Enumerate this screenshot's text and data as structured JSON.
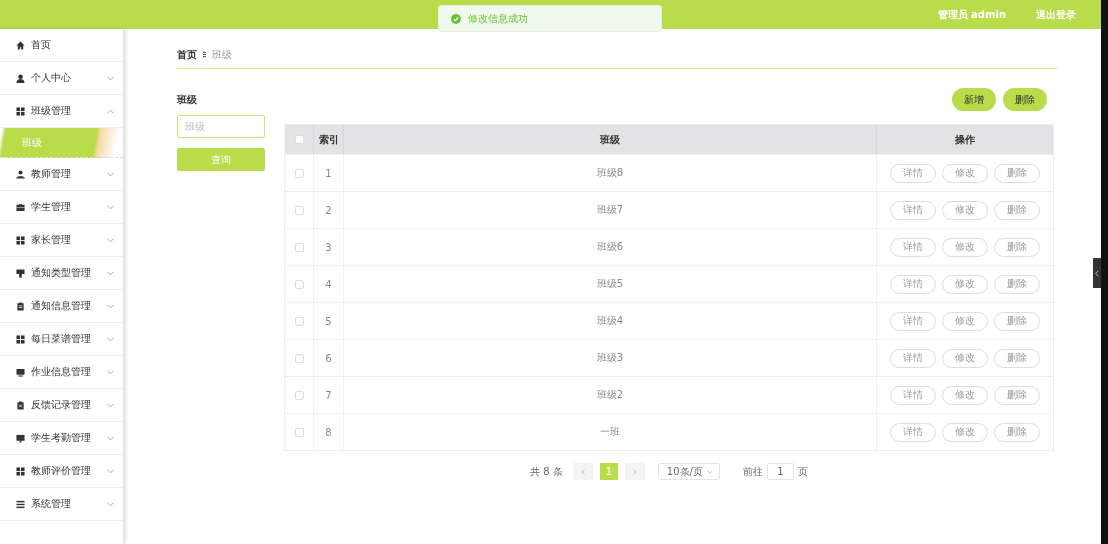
{
  "header": {
    "user": "管理员 admin",
    "logout": "退出登录"
  },
  "toast": {
    "message": "修改信息成功"
  },
  "sidebar": {
    "items": [
      {
        "label": "首页",
        "kind": "link"
      },
      {
        "label": "个人中心",
        "kind": "group",
        "expanded": false
      },
      {
        "label": "班级管理",
        "kind": "group",
        "expanded": true,
        "children": [
          {
            "label": "班级",
            "selected": true
          }
        ]
      },
      {
        "label": "教师管理",
        "kind": "group",
        "expanded": false
      },
      {
        "label": "学生管理",
        "kind": "group",
        "expanded": false
      },
      {
        "label": "家长管理",
        "kind": "group",
        "expanded": false
      },
      {
        "label": "通知类型管理",
        "kind": "group",
        "expanded": false
      },
      {
        "label": "通知信息管理",
        "kind": "group",
        "expanded": false
      },
      {
        "label": "每日菜谱管理",
        "kind": "group",
        "expanded": false
      },
      {
        "label": "作业信息管理",
        "kind": "group",
        "expanded": false
      },
      {
        "label": "反馈记录管理",
        "kind": "group",
        "expanded": false
      },
      {
        "label": "学生考勤管理",
        "kind": "group",
        "expanded": false
      },
      {
        "label": "教师评价管理",
        "kind": "group",
        "expanded": false
      },
      {
        "label": "系统管理",
        "kind": "group",
        "expanded": false
      }
    ]
  },
  "breadcrumb": [
    "首页",
    "班级"
  ],
  "search": {
    "label": "班级",
    "placeholder": "班级",
    "button": "查询"
  },
  "actions": [
    "新增",
    "删除"
  ],
  "table": {
    "columns": [
      "",
      "索引",
      "班级",
      "操作"
    ],
    "rows": [
      {
        "checked": false,
        "index": "1",
        "class": "班级8",
        "ops": [
          "详情",
          "修改",
          "删除"
        ]
      },
      {
        "checked": false,
        "index": "2",
        "class": "班级7",
        "ops": [
          "详情",
          "修改",
          "删除"
        ]
      },
      {
        "checked": false,
        "index": "3",
        "class": "班级6",
        "ops": [
          "详情",
          "修改",
          "删除"
        ]
      },
      {
        "checked": false,
        "index": "4",
        "class": "班级5",
        "ops": [
          "详情",
          "修改",
          "删除"
        ]
      },
      {
        "checked": false,
        "index": "5",
        "class": "班级4",
        "ops": [
          "详情",
          "修改",
          "删除"
        ]
      },
      {
        "checked": false,
        "index": "6",
        "class": "班级3",
        "ops": [
          "详情",
          "修改",
          "删除"
        ]
      },
      {
        "checked": false,
        "index": "7",
        "class": "班级2",
        "ops": [
          "详情",
          "修改",
          "删除"
        ]
      },
      {
        "checked": false,
        "index": "8",
        "class": "一班",
        "ops": [
          "详情",
          "修改",
          "删除"
        ]
      }
    ],
    "all_checked": false
  },
  "pagination": {
    "total": "共 8 条",
    "pages": [
      {
        "label": "1",
        "selected": true
      }
    ],
    "page_size": "10条/页",
    "goto": "前往",
    "goto_value": "1",
    "page_unit": "页"
  }
}
